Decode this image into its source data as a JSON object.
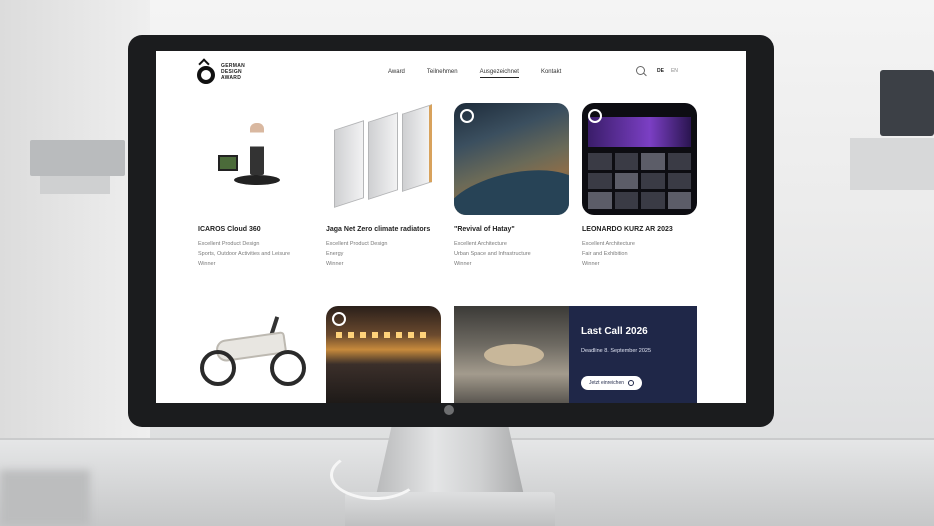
{
  "site": {
    "brand_lines": [
      "GERMAN",
      "DESIGN",
      "AWARD"
    ],
    "nav": [
      {
        "label": "Award",
        "active": false
      },
      {
        "label": "Teilnehmen",
        "active": false
      },
      {
        "label": "Ausgezeichnet",
        "active": true
      },
      {
        "label": "Kontakt",
        "active": false
      }
    ],
    "languages": [
      "DE",
      "EN"
    ],
    "active_language": "DE"
  },
  "cards": [
    {
      "title": "ICAROS Cloud 360",
      "meta": [
        "Excellent Product Design",
        "Sports, Outdoor Activities and Leisure",
        "Winner"
      ]
    },
    {
      "title": "Jaga Net Zero climate radiators",
      "meta": [
        "Excellent Product Design",
        "Energy",
        "Winner"
      ]
    },
    {
      "title": "\"Revival of Hatay\"",
      "meta": [
        "Excellent Architecture",
        "Urban Space and Infrastructure",
        "Winner"
      ]
    },
    {
      "title": "LEONARDO KURZ AR 2023",
      "meta": [
        "Excellent Architecture",
        "Fair and Exhibition",
        "Winner"
      ]
    }
  ],
  "promo": {
    "headline": "Last Call 2026",
    "subline": "Deadline 8. September 2025",
    "cta_label": "Jetzt einreichen"
  },
  "colors": {
    "promo_bg": "#1f2748",
    "screen_bg": "#ffffff",
    "bezel": "#1b1c1e"
  }
}
